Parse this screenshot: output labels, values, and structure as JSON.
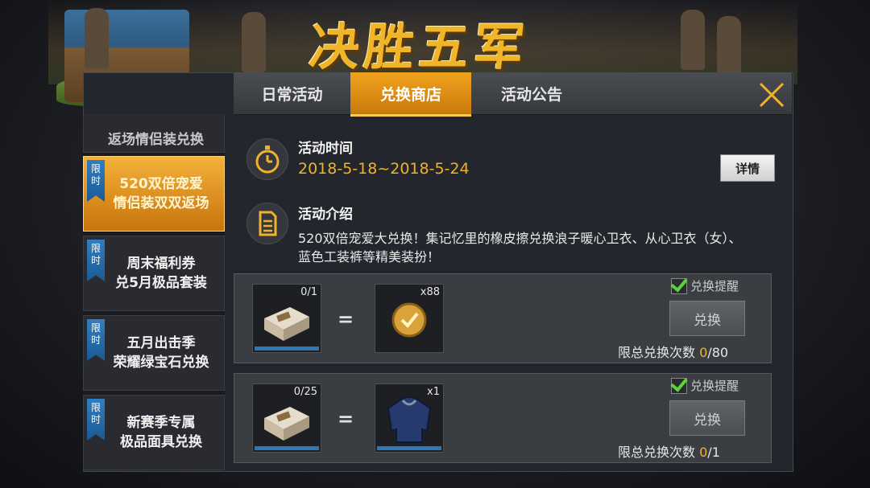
{
  "banner": {
    "title": "决胜五军"
  },
  "tabs": [
    {
      "label": "日常活动"
    },
    {
      "label": "兑换商店"
    },
    {
      "label": "活动公告"
    }
  ],
  "sidebar": {
    "partial_label": "返场情侣装兑换",
    "items": [
      {
        "badge": "限时",
        "line1": "520双倍宠爱",
        "line2": "情侣装双双返场"
      },
      {
        "badge": "限时",
        "line1": "周末福利券",
        "line2": "兑5月极品套装"
      },
      {
        "badge": "限时",
        "line1": "五月出击季",
        "line2": "荣耀绿宝石兑换"
      },
      {
        "badge": "限时",
        "line1": "新赛季专属",
        "line2": "极品面具兑换"
      }
    ]
  },
  "activity": {
    "time_label": "活动时间",
    "time_value": "2018-5-18~2018-5-24",
    "detail_button": "详情",
    "intro_label": "活动介绍",
    "intro_text": "520双倍宠爱大兑换！集记忆里的橡皮擦兑换浪子暖心卫衣、从心卫衣（女）、蓝色工装裤等精美装扮！"
  },
  "exchanges": [
    {
      "cost_count": "0/1",
      "reward_count": "x88",
      "remind_label": "兑换提醒",
      "button": "兑换",
      "limit_label": "限总兑换次数",
      "limit_used": "0",
      "limit_total": "/80"
    },
    {
      "cost_count": "0/25",
      "reward_count": "x1",
      "remind_label": "兑换提醒",
      "button": "兑换",
      "limit_label": "限总兑换次数",
      "limit_used": "0",
      "limit_total": "/1"
    }
  ],
  "colors": {
    "accent": "#f0a21c",
    "date": "#f0b22d",
    "badge": "#2e7fc4"
  }
}
